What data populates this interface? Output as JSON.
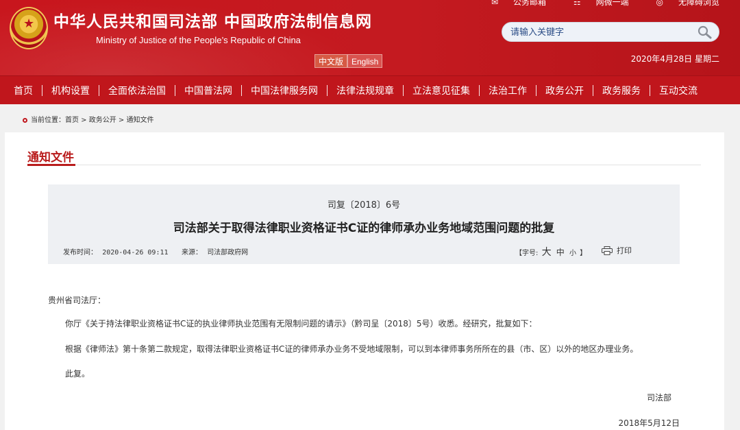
{
  "header": {
    "title": "中华人民共和国司法部  中国政府法制信息网",
    "subtitle": "Ministry of Justice of the People’s Republic of China",
    "lang_zh": "中文版",
    "lang_en": "English",
    "toplinks": [
      "公务邮箱",
      "网微一端",
      "无障碍浏览"
    ],
    "search_placeholder": "请输入关键字",
    "date": "2020年4月28日 星期二"
  },
  "nav": {
    "items": [
      "首页",
      "机构设置",
      "全面依法治国",
      "中国普法网",
      "中国法律服务网",
      "法律法规规章",
      "立法意见征集",
      "法治工作",
      "政务公开",
      "政务服务",
      "互动交流"
    ]
  },
  "breadcrumb": "当前位置：首页 > 政务公开 > 通知文件",
  "section": {
    "title": "通知文件"
  },
  "doc": {
    "number": "司复〔2018〕6号",
    "title": "司法部关于取得法律职业资格证书C证的律师承办业务地域范围问题的批复",
    "publish_label": "发布时间：",
    "publish_time": "2020-04-26 09:11",
    "source_label": "来源：",
    "source": "司法部政府网",
    "font_label": "【字号:",
    "font_big": "大",
    "font_mid": "中",
    "font_small": "小",
    "font_end": "】",
    "print": "打印"
  },
  "body": {
    "salutation": "贵州省司法厅：",
    "p1": "你厅《关于持法律职业资格证书C证的执业律师执业范围有无限制问题的请示》（黔司呈〔2018〕5号）收悉。经研究，批复如下：",
    "p2": "根据《律师法》第十条第二款规定，取得法律职业资格证书C证的律师承办业务不受地域限制，可以到本律师事务所所在的县（市、区）以外的地区办理业务。",
    "p3": "此复。",
    "signer": "司法部",
    "sign_date": "2018年5月12日"
  }
}
